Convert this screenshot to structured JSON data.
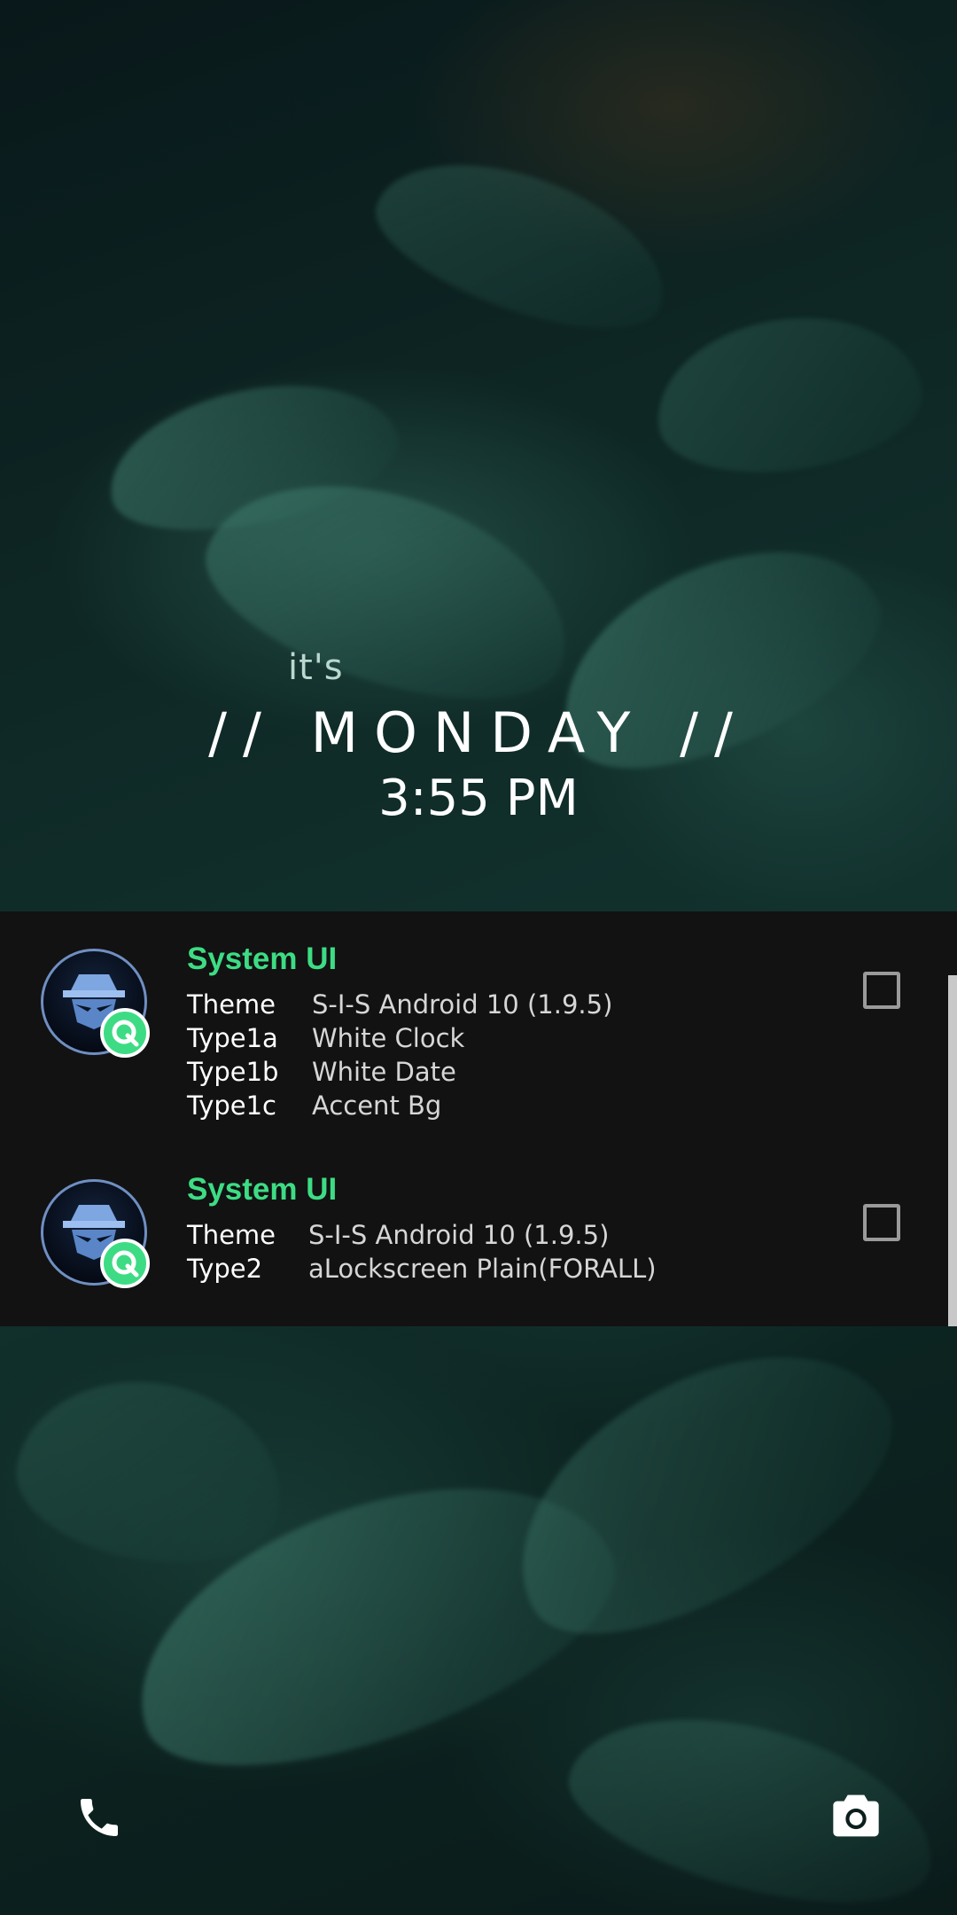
{
  "lockscreen": {
    "its_label": "it's",
    "day_label": "// MONDAY //",
    "time": "3:55 PM"
  },
  "notifications": [
    {
      "app_name": "System UI",
      "rows": [
        {
          "key": "Theme",
          "value": "S-I-S Android 10 (1.9.5)"
        },
        {
          "key": "Type1a",
          "value": "White Clock"
        },
        {
          "key": "Type1b",
          "value": "White Date"
        },
        {
          "key": "Type1c",
          "value": "Accent Bg"
        }
      ],
      "checked": false
    },
    {
      "app_name": "System UI",
      "rows": [
        {
          "key": "Theme",
          "value": "S-I-S Android 10 (1.9.5)"
        },
        {
          "key": "Type2",
          "value": "aLockscreen Plain(FORALL)"
        }
      ],
      "checked": false
    }
  ],
  "shortcuts": {
    "left_icon": "phone-icon",
    "right_icon": "camera-icon"
  },
  "colors": {
    "accent": "#3ddc84",
    "panel_bg": "#121212"
  }
}
